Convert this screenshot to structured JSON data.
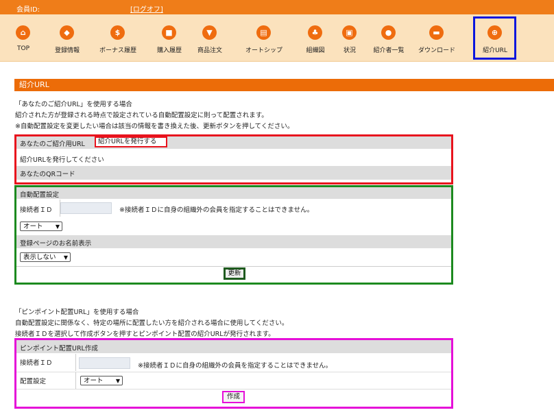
{
  "topbar": {
    "member_id_label": "会員ID:",
    "logoff_label": "[ログオフ]"
  },
  "nav": {
    "items": [
      {
        "label": "TOP",
        "icon": "home-icon",
        "glyph": "⌂"
      },
      {
        "label": "登録情報",
        "icon": "id-card-icon",
        "glyph": "◆"
      },
      {
        "label": "ボーナス履歴",
        "icon": "dollar-icon",
        "glyph": "$"
      },
      {
        "label": "購入履歴",
        "icon": "bag-icon",
        "glyph": "■"
      },
      {
        "label": "商品注文",
        "icon": "cart-icon",
        "glyph": "▼"
      },
      {
        "label": "オートシップ",
        "icon": "calendar-icon",
        "glyph": "▤"
      },
      {
        "label": "組織図",
        "icon": "org-chart-icon",
        "glyph": "♣"
      },
      {
        "label": "状況",
        "icon": "chart-icon",
        "glyph": "▣"
      },
      {
        "label": "紹介者一覧",
        "icon": "users-icon",
        "glyph": "●"
      },
      {
        "label": "ダウンロード",
        "icon": "folder-icon",
        "glyph": "▬"
      },
      {
        "label": "紹介URL",
        "icon": "globe-icon",
        "glyph": "⊕"
      }
    ]
  },
  "section_title": "紹介URL",
  "intro": {
    "line1": "「あなたのご紹介URL」を使用する場合",
    "line2": "紹介された方が登録される時点で設定されている自動配置設定に則って配置されます。",
    "line3": "※自動配置設定を変更したい場合は該当の情報を書き換えた後、更新ボタンを押してください。"
  },
  "url_block": {
    "header_label": "あなたのご紹介用URL",
    "issue_button": "紹介URLを発行する",
    "placeholder_text": "紹介URLを発行してください",
    "qr_label": "あなたのQRコード"
  },
  "auto_block": {
    "header": "自動配置設定",
    "connector_label": "接続者ＩＤ",
    "connector_note": "※接続者ＩＤに自身の組織外の会員を指定することはできません。",
    "position_select": "オート",
    "name_display_header": "登録ページのお名前表示",
    "name_display_select": "表示しない",
    "update_button": "更新"
  },
  "pinpoint_intro": {
    "line1": "「ピンポイント配置URL」を使用する場合",
    "line2": "自動配置設定に関係なく、特定の場所に配置したい方を紹介される場合に使用してください。",
    "line3": "接続者ＩＤを選択して作成ボタンを押すとピンポイント配置の紹介URLが発行されます。"
  },
  "pinpoint_block": {
    "header": "ピンポイント配置URL作成",
    "connector_label": "接続者ＩＤ",
    "connector_note": "※接続者ＩＤに自身の組織外の会員を指定することはできません。",
    "placement_label": "配置設定",
    "placement_select": "オート",
    "create_button": "作成"
  }
}
